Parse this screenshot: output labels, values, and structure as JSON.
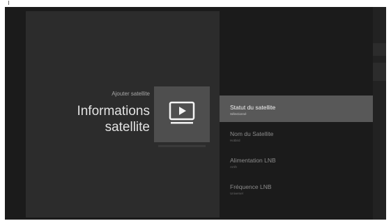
{
  "screen": {
    "subtitle": "Ajouter satellite",
    "title_line1": "Informations",
    "title_line2": "satellite",
    "tile_icon": "tv-play-icon"
  },
  "menu": {
    "items": [
      {
        "title": "Statut du satellite",
        "value": "Sélectionné",
        "selected": true
      },
      {
        "title": "Nom du Satellite",
        "value": "Hotbird",
        "selected": false
      },
      {
        "title": "Alimentation LNB",
        "value": "Arrêt",
        "selected": false
      },
      {
        "title": "Fréquence LNB",
        "value": "Universel",
        "selected": false
      }
    ]
  },
  "colors": {
    "background": "#1b1b1b",
    "left_panel": "#2c2c2c",
    "tile": "#4e4e4e",
    "selected_item": "#585858"
  }
}
